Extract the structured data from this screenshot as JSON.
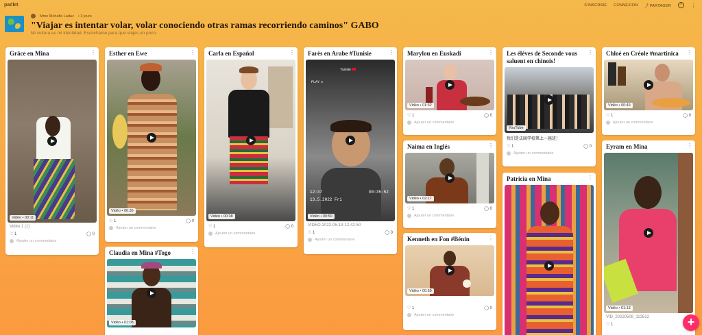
{
  "app": {
    "brand": "padlet",
    "actions": [
      "S'INSCRIRE",
      "CONNEXION",
      "PARTAGER"
    ],
    "help_icon": "?",
    "more_icon": "⋮"
  },
  "header": {
    "author": "Mme Mohafle Ladaz",
    "time": "3 jours",
    "title": "\"Viajar es intentar volar, volar conociendo otras ramas recorriendo caminos\" GABO",
    "subtitle": "Mi cultura es mi identidad. Escúchame para que viajes un poco."
  },
  "cards": [
    {
      "title": "Grâce en Mina",
      "duration": "Vidéo • 00:11",
      "caption": "Vidéo 1 (1)",
      "likes": "1",
      "comments": "0",
      "comment_placeholder": "Ajouter un commentaire"
    },
    {
      "title": "Esther en Ewe",
      "duration": "Vidéo • 00:36",
      "likes": "1",
      "comments": "0",
      "comment_placeholder": "Ajouter un commentaire"
    },
    {
      "title": "Claudia en Mina #Togo",
      "duration": "Vidéo • 01:08"
    },
    {
      "title": "Carla en Español",
      "duration": "Vidéo • 00:38",
      "likes": "1",
      "comments": "0",
      "comment_placeholder": "Ajouter un commentaire"
    },
    {
      "title": "Farès en Arabe #Tunisie",
      "duration": "Vidéo • 00:50",
      "caption": "VIDEO-2022-05-13-12-42-50",
      "likes": "1",
      "comments": "0",
      "comment_placeholder": "Ajouter un commentaire",
      "overlay": {
        "top": "Tunisie",
        "play": "PLAY ▸",
        "time_left": "12:37",
        "time_right": "00:35:52",
        "date": "13.5.2022 Fri"
      }
    },
    {
      "title": "Marylou en Euskadi",
      "duration": "Vidéo • 01:32",
      "likes": "1",
      "comments": "0",
      "comment_placeholder": "Ajouter un commentaire"
    },
    {
      "title": "Naima en Inglés",
      "duration": "Vidéo • 02:17",
      "likes": "1",
      "comments": "0",
      "comment_placeholder": "Ajouter un commentaire"
    },
    {
      "title": "Kenneth en Fon #Bénin",
      "duration": "Vidéo • 00:59",
      "likes": "1",
      "comments": "0",
      "comment_placeholder": "Ajouter un commentaire"
    },
    {
      "title": "Les élèves de Seconde vous saluent en chinois!",
      "duration": "YouTube",
      "caption": "我们是法国学校第上一届班！",
      "likes": "1",
      "comments": "0",
      "comment_placeholder": "Ajouter un commentaire"
    },
    {
      "title": "Patricia en Mina"
    },
    {
      "title": "Chloé en Créole #martinica",
      "duration": "Vidéo • 00:49",
      "likes": "1",
      "comments": "0",
      "comment_placeholder": "Ajouter un commentaire"
    },
    {
      "title": "Eyram en Mina",
      "duration": "Vidéo • 01:13",
      "caption": "VID_20220508_113612",
      "likes": "1"
    }
  ],
  "colors": {
    "background_top": "#f5b84a",
    "background_bottom": "#fb9a3f",
    "add_button": "#ff2c6a"
  },
  "add_button_label": "+"
}
